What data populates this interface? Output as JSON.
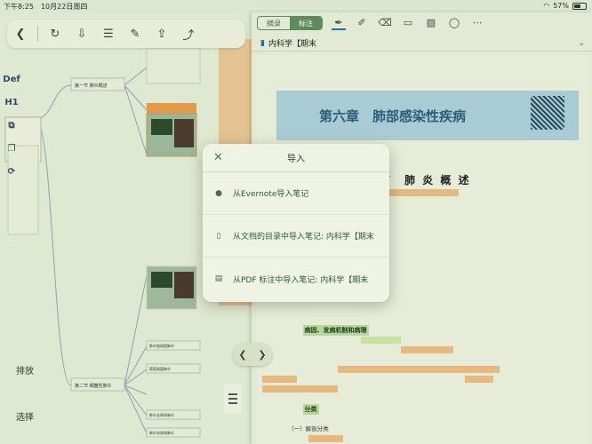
{
  "status_bar": {
    "time": "下午8:25",
    "date": "10月22日周四",
    "battery": "57%",
    "battery_level": 0.57
  },
  "left_toolbar": {
    "icons": [
      "back-icon",
      "redo-icon",
      "download-icon",
      "list-icon",
      "edit-icon",
      "export-icon",
      "share-icon"
    ]
  },
  "side_tools": {
    "def": "Def",
    "h1": "H1"
  },
  "bottom_left": {
    "zoom_label": "排放",
    "select_label": "选择"
  },
  "right_toolbar": {
    "tabs": [
      {
        "label": "摘录"
      },
      {
        "label": "标注"
      }
    ]
  },
  "document": {
    "title": "内科学【期末",
    "chapter": "第六章　肺部感染性疾病",
    "section": "节　肺 炎 概 述",
    "subhead1": "病因、发病机制和病理",
    "subhead2": "分类",
    "subhead3": "（一）解剖分类"
  },
  "modal": {
    "title": "导入",
    "items": [
      {
        "label": "从Evernote导入笔记",
        "icon": "evernote-icon"
      },
      {
        "label": "从文档的目录中导入笔记: 内科学【期末",
        "icon": "book-icon"
      },
      {
        "label": "从PDF 标注中导入笔记: 内科学【期末",
        "icon": "pdf-icon"
      }
    ]
  },
  "mindmap_nodes": {
    "node1": "第一节 肺炎概述",
    "node2": "第二节 细菌性肺炎",
    "node3": "肺炎链球菌肺炎",
    "node4": "葡萄球菌肺炎",
    "node5": "肺炎支原体肺炎",
    "node6": "肺炎衣原体肺炎"
  }
}
